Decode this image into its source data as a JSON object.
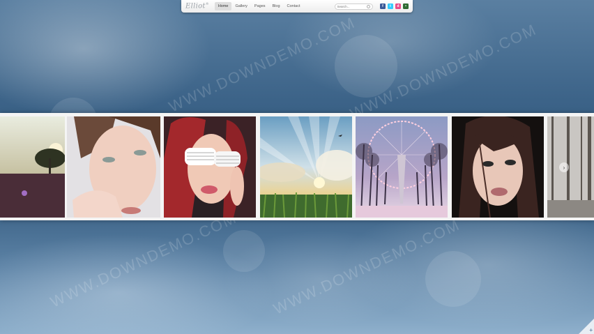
{
  "brand": {
    "name": "Elliot",
    "mark": "®"
  },
  "nav": {
    "items": [
      "Home",
      "Gallery",
      "Pages",
      "Blog",
      "Contact"
    ],
    "active_index": 0
  },
  "search": {
    "placeholder": "Search..."
  },
  "social": [
    {
      "icon": "facebook-icon",
      "glyph": "f",
      "color": "#3b5998"
    },
    {
      "icon": "twitter-icon",
      "glyph": "t",
      "color": "#33ccff"
    },
    {
      "icon": "dribbble-icon",
      "glyph": "d",
      "color": "#ea4c89"
    },
    {
      "icon": "flickr-icon",
      "glyph": "•",
      "color": "#2f6b34"
    }
  ],
  "gallery": {
    "photos": [
      {
        "subject": "sunset-field-tree"
      },
      {
        "subject": "portrait-girl-hand"
      },
      {
        "subject": "portrait-redhead-glasses"
      },
      {
        "subject": "sky-sunbeams-grass"
      },
      {
        "subject": "ferris-wheel-avenue"
      },
      {
        "subject": "portrait-dark-hair"
      },
      {
        "subject": "misty-forest"
      }
    ]
  },
  "controls": {
    "next_glyph": "›",
    "corner_glyph": "+"
  },
  "watermark": "WWW.DOWNDEMO.COM"
}
